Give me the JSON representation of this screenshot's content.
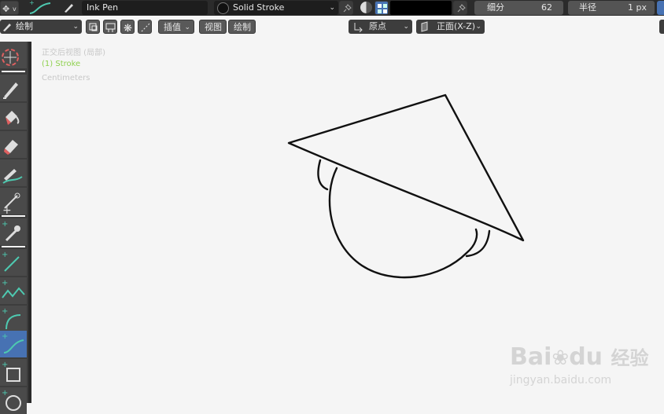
{
  "header": {
    "brush_name": "Ink Pen",
    "material_name": "Solid Stroke",
    "subdivide_label": "细分",
    "subdivide_value": "62",
    "radius_label": "半径",
    "radius_value": "1 px"
  },
  "toolbar2": {
    "mode_label": "绘制",
    "interpolate_label": "插值",
    "view_label": "视图",
    "draw_label": "绘制",
    "origin_label": "原点",
    "placement_label": "正面(X-Z)"
  },
  "viewport": {
    "view_name": "正交后视图 (局部)",
    "object_name": "(1) Stroke",
    "units": "Centimeters"
  },
  "tools": [
    {
      "name": "cursor-tool-icon",
      "active": false
    },
    {
      "name": "draw-tool-icon",
      "active": false
    },
    {
      "name": "fill-tool-icon",
      "active": false
    },
    {
      "name": "erase-tool-icon",
      "active": false
    },
    {
      "name": "tint-tool-icon",
      "active": false
    },
    {
      "name": "cutter-tool-icon",
      "active": false
    },
    {
      "name": "eyedropper-tool-icon",
      "active": false
    },
    {
      "name": "line-tool-icon",
      "active": false
    },
    {
      "name": "polyline-tool-icon",
      "active": false
    },
    {
      "name": "arc-tool-icon",
      "active": false
    },
    {
      "name": "curve-tool-icon",
      "active": true
    },
    {
      "name": "box-tool-icon",
      "active": false
    },
    {
      "name": "circle-tool-icon",
      "active": false
    }
  ],
  "watermark": {
    "brand": "Bai",
    "brand2": "du",
    "brand_cn": "经验",
    "url": "jingyan.baidu.com"
  },
  "colors": {
    "accent": "#4772b3",
    "panel": "#303030",
    "canvas": "#f5f5f5",
    "stroke": "#111111"
  }
}
